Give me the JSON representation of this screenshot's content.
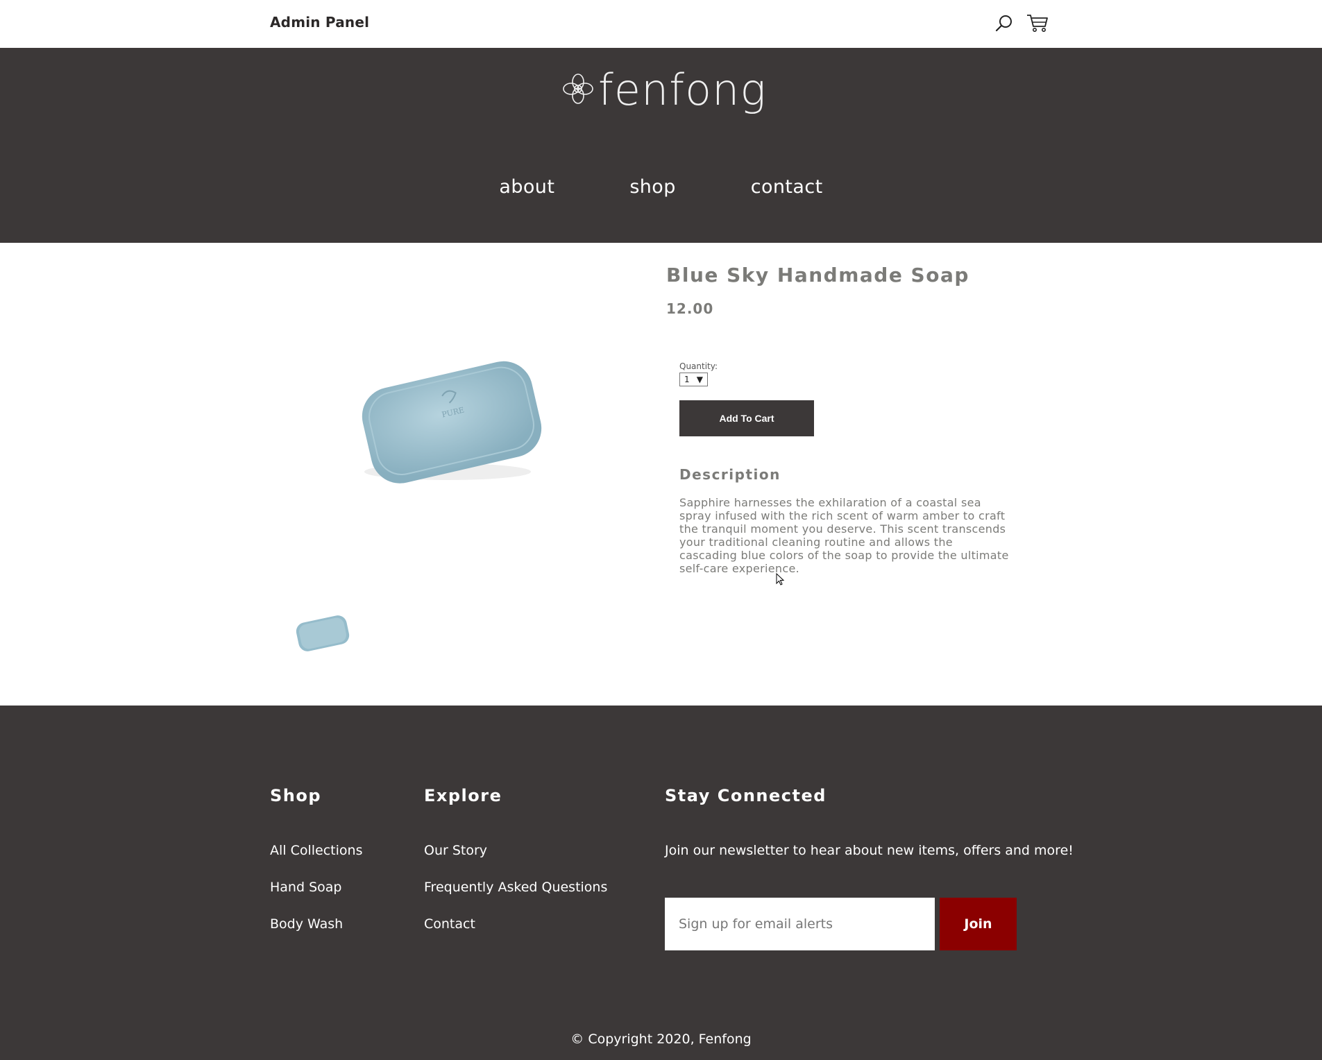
{
  "topbar": {
    "admin_label": "Admin Panel",
    "search_icon": "search-icon",
    "cart_icon": "cart-icon"
  },
  "header": {
    "logo_text": "fenfong",
    "nav": [
      {
        "label": "about"
      },
      {
        "label": "shop"
      },
      {
        "label": "contact"
      }
    ]
  },
  "product": {
    "title": "Blue Sky Handmade Soap",
    "price": "12.00",
    "quantity_label": "Quantity:",
    "quantity_value": "1",
    "add_to_cart_label": "Add To Cart",
    "description_title": "Description",
    "description": "Sapphire harnesses the exhilaration of a coastal sea spray infused with the rich scent of warm amber to craft the tranquil moment you deserve. This scent transcends your traditional cleaning routine and allows the cascading blue colors of the soap to provide the ultimate self-care experience.",
    "image_color": "#9fc2cf"
  },
  "footer": {
    "shop": {
      "title": "Shop",
      "links": [
        "All Collections",
        "Hand Soap",
        "Body Wash"
      ]
    },
    "explore": {
      "title": "Explore",
      "links": [
        "Our Story",
        "Frequently Asked Questions",
        "Contact"
      ]
    },
    "connect": {
      "title": "Stay Connected",
      "text": "Join our newsletter to hear about new items, offers and more!",
      "email_placeholder": "Sign up for email alerts",
      "join_label": "Join"
    },
    "copyright": "© Copyright 2020, Fenfong"
  },
  "colors": {
    "header_bg": "#3c3838",
    "join_button": "#8b0000",
    "text_muted": "#7b7b78"
  }
}
